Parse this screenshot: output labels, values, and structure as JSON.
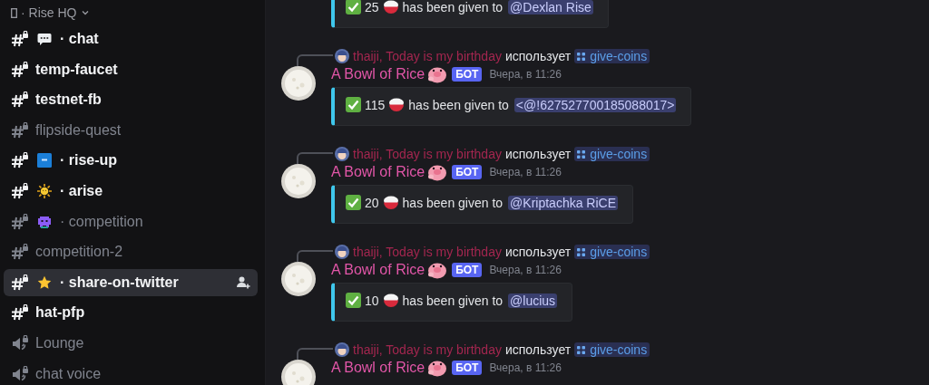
{
  "server": {
    "name": "· Rise HQ"
  },
  "channels": [
    {
      "kind": "text",
      "emoji": {
        "kind": "bubble"
      },
      "label": "· chat",
      "unread": true,
      "selected": false
    },
    {
      "kind": "text",
      "label": "temp-faucet",
      "unread": true,
      "selected": false
    },
    {
      "kind": "text",
      "label": "testnet-fb",
      "unread": true,
      "selected": false
    },
    {
      "kind": "text",
      "label": "flipside-quest",
      "unread": false,
      "selected": false
    },
    {
      "kind": "text",
      "emoji": {
        "kind": "up"
      },
      "label": "· rise-up",
      "unread": true,
      "selected": false
    },
    {
      "kind": "text",
      "emoji": {
        "kind": "sun"
      },
      "label": "· arise",
      "unread": true,
      "selected": false
    },
    {
      "kind": "text",
      "emoji": {
        "kind": "alien"
      },
      "label": "· competition",
      "unread": false,
      "selected": false
    },
    {
      "kind": "text",
      "label": "competition-2",
      "unread": false,
      "selected": false
    },
    {
      "kind": "text",
      "emoji": {
        "kind": "star"
      },
      "label": "· share-on-twitter",
      "unread": true,
      "selected": true
    },
    {
      "kind": "text",
      "label": "hat-pfp",
      "unread": true,
      "selected": false
    },
    {
      "kind": "voice",
      "label": "Lounge",
      "unread": false,
      "selected": false
    },
    {
      "kind": "voice",
      "label": "chat voice",
      "unread": false,
      "selected": false
    }
  ],
  "messages": [
    {
      "embed": {
        "amount": "25",
        "text": "has been given to",
        "mention": "@Dexlan Rise"
      }
    },
    {
      "reply": {
        "user": "thaiji, Today is my birthday",
        "verb": "использует",
        "command": "give-coins"
      },
      "author": "A Bowl of Rice",
      "tag": "БОТ",
      "time": "Вчера, в 11:26",
      "embed": {
        "amount": "115",
        "text": "has been given to",
        "mention": "<@!627527700185088017>"
      }
    },
    {
      "reply": {
        "user": "thaiji, Today is my birthday",
        "verb": "использует",
        "command": "give-coins"
      },
      "author": "A Bowl of Rice",
      "tag": "БОТ",
      "time": "Вчера, в 11:26",
      "embed": {
        "amount": "20",
        "text": "has been given to",
        "mention": "@Kriptachka RiCE"
      }
    },
    {
      "reply": {
        "user": "thaiji, Today is my birthday",
        "verb": "использует",
        "command": "give-coins"
      },
      "author": "A Bowl of Rice",
      "tag": "БОТ",
      "time": "Вчера, в 11:26",
      "embed": {
        "amount": "10",
        "text": "has been given to",
        "mention": "@lucius"
      }
    },
    {
      "reply": {
        "user": "thaiji, Today is my birthday",
        "verb": "использует",
        "command": "give-coins"
      },
      "author": "A Bowl of Rice",
      "tag": "БОТ",
      "time": "Вчера, в 11:26"
    }
  ]
}
